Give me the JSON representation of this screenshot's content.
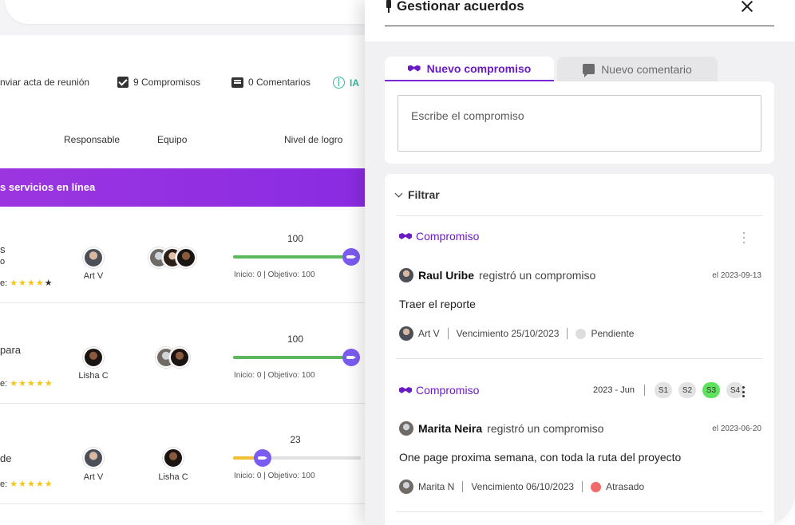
{
  "background": {
    "toolbar": {
      "send_minutes": "nviar acta de reunión",
      "commitments": "9 Compromisos",
      "comments": "0 Comentarios",
      "ai": "IA"
    },
    "columns": {
      "responsible": "Responsable",
      "team": "Equipo",
      "achievement": "Nivel de logro"
    },
    "group_title": "s servicios en línea",
    "rows": [
      {
        "text": "s",
        "text2": "o",
        "rating_prefix": "e:",
        "stars_filled": "★★★★",
        "stars_empty": "★",
        "responsible": "Art V",
        "progress_value": "100",
        "progress_fraction": 1.0,
        "progress_color": "#5cb85c",
        "progress_caption": "Inicio: 0 | Objetivo: 100"
      },
      {
        "text": "para",
        "rating_prefix": "e:",
        "stars_filled": "★★★★★",
        "responsible": "Lisha C",
        "progress_value": "100",
        "progress_fraction": 1.0,
        "progress_color": "#5cb85c",
        "progress_caption": "Inicio: 0 | Objetivo: 100"
      },
      {
        "text": "de",
        "rating_prefix": "e:",
        "stars_filled": "★★★★★",
        "responsible": "Art V",
        "team_member": "Lisha C",
        "progress_value": "23",
        "progress_fraction": 0.23,
        "progress_color": "#f0c030",
        "progress_caption": "Inicio: 0 | Objetivo: 100"
      }
    ]
  },
  "drawer": {
    "title": "Gestionar acuerdos",
    "tabs": [
      {
        "label": "Nuevo compromiso",
        "active": true,
        "icon": "handshake-icon"
      },
      {
        "label": "Nuevo comentario",
        "active": false,
        "icon": "comment-icon"
      }
    ],
    "input_placeholder": "Escribe el compromiso",
    "filter_label": "Filtrar",
    "items": [
      {
        "type_label": "Compromiso",
        "author": "Raul Uribe",
        "action": "registró un compromiso",
        "date": "el 2023-09-13",
        "description": "Traer el reporte",
        "assignee": "Art V",
        "due": "Vencimiento 25/10/2023",
        "status": "Pendiente",
        "status_color": "#dddddd"
      },
      {
        "type_label": "Compromiso",
        "period": "2023 - Jun",
        "weeks": [
          {
            "label": "S1",
            "done": false
          },
          {
            "label": "S2",
            "done": false
          },
          {
            "label": "S3",
            "done": true
          },
          {
            "label": "S4",
            "done": false
          }
        ],
        "author": "Marita Neira",
        "action": "registró un compromiso",
        "date": "el 2023-06-20",
        "description": "One page proxima semana, con toda la ruta del proyecto",
        "assignee": "Marita N",
        "due": "Vencimiento 06/10/2023",
        "status": "Atrasado",
        "status_color": "#ef6b6b"
      }
    ]
  },
  "colors": {
    "accent_purple": "#6a1bc4",
    "group_bar": "#8a2be2",
    "ai_green": "#3bb39a",
    "star_yellow": "#f5c518"
  }
}
